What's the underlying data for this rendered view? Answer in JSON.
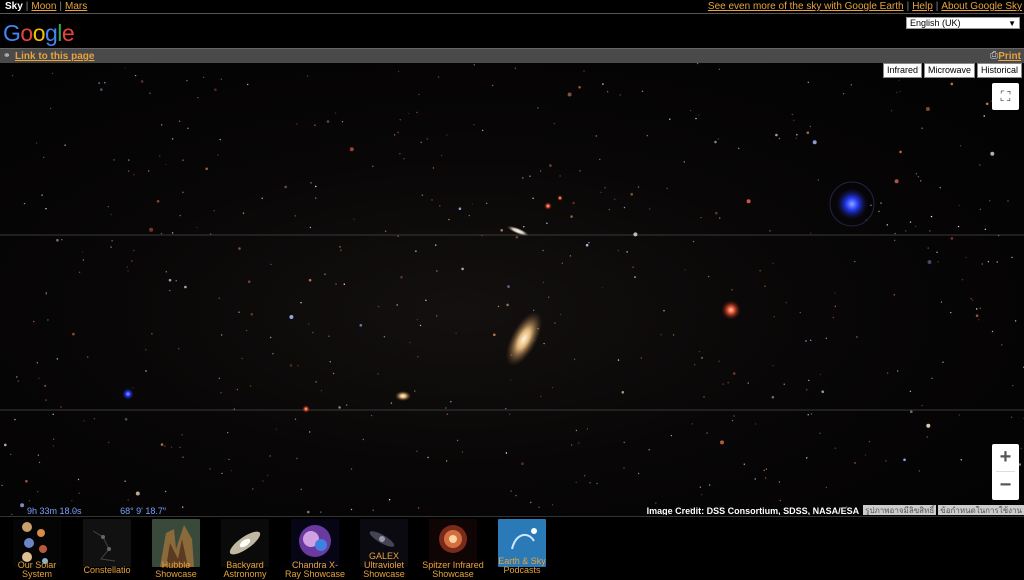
{
  "nav": {
    "sky": "Sky",
    "moon": "Moon",
    "mars": "Mars",
    "earth_link": "See even more of the sky with Google Earth",
    "help": "Help",
    "about": "About Google Sky"
  },
  "header": {
    "logo_google": "Google",
    "logo_product": "Sky",
    "language": "English (UK)"
  },
  "toolbar": {
    "link_label": "Link to this page",
    "print_label": "Print"
  },
  "layers": [
    "Infrared",
    "Microwave",
    "Historical"
  ],
  "map": {
    "ra": "9h 33m 18.0s",
    "dec": "68° 9' 18.7\"",
    "credit": "Image Credit: DSS Consortium, SDSS, NASA/ESA",
    "copyright_link": "รูปภาพอาจมีลิขสิทธิ์",
    "terms_link": "ข้อกำหนดในการใช้งาน",
    "zoom_in": "+",
    "zoom_out": "−"
  },
  "showcase": [
    {
      "label": "Our Solar System",
      "icon": "solar-system-icon"
    },
    {
      "label": "Constellatio",
      "icon": "constellation-icon"
    },
    {
      "label": "Hubble Showcase",
      "icon": "hubble-icon"
    },
    {
      "label": "Backyard Astronomy",
      "icon": "backyard-icon"
    },
    {
      "label": "Chandra X-Ray Showcase",
      "icon": "chandra-icon"
    },
    {
      "label": "GALEX Ultraviolet Showcase",
      "icon": "galex-icon"
    },
    {
      "label": "Spitzer Infrared Showcase",
      "icon": "spitzer-icon"
    },
    {
      "label": "Earth & Sky Podcasts",
      "icon": "podcast-icon"
    }
  ],
  "colors": {
    "link": "#e8a33c",
    "coords": "#7aa0ff",
    "background": "#000000"
  }
}
